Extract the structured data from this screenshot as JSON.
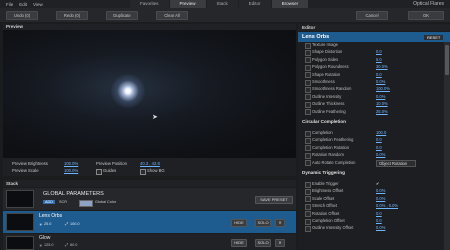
{
  "menu": [
    "File",
    "Edit",
    "View"
  ],
  "tabs": [
    {
      "label": "Favorites",
      "active": false
    },
    {
      "label": "Preview",
      "active": true
    },
    {
      "label": "Stack",
      "active": false
    },
    {
      "label": "Editor",
      "active": false
    },
    {
      "label": "Browser",
      "active": false
    }
  ],
  "app_title": "Optical Flares",
  "toolbar": {
    "undo": "Undo (0)",
    "redo": "Redo (0)",
    "duplicate": "Duplicate",
    "clear_all": "Clear All",
    "cancel": "Cancel",
    "ok": "OK"
  },
  "preview": {
    "heading": "Preview",
    "brightness_label": "Preview Brightness",
    "brightness_value": "100.0%",
    "scale_label": "Preview Scale",
    "scale_value": "100.0%",
    "position_label": "Preview Position",
    "position_value": "40.3 , 42.8",
    "guides_label": "Guides",
    "show_bg_label": "Show BG"
  },
  "stack": {
    "heading": "Stack",
    "global_title": "GLOBAL PARAMETERS",
    "global_tags": [
      "ADD",
      "SCR"
    ],
    "global_color_label": "Global Color",
    "save_preset": "SAVE PRESET",
    "items": [
      {
        "name": "Lens Orbs",
        "brightness": "25.0",
        "scale": "100.0",
        "hide": "HIDE",
        "solo": "SOLO",
        "selected": true
      },
      {
        "name": "Glow",
        "brightness": "125.0",
        "scale": "80.0",
        "hide": "HIDE",
        "solo": "SOLO",
        "selected": false
      }
    ]
  },
  "editor": {
    "heading": "Editor",
    "title": "Lens Orbs",
    "reset": "RESET",
    "rows_top": [
      {
        "label": "Texture Image",
        "value": ""
      },
      {
        "label": "Shape Distortion",
        "value": "0.0"
      },
      {
        "label": "Polygon Sides",
        "value": "6.0"
      },
      {
        "label": "Polygon Roundness",
        "value": "30.0%"
      },
      {
        "label": "Shape Rotation",
        "value": "0.0"
      },
      {
        "label": "Smoothness",
        "value": "0.0%"
      },
      {
        "label": "Smoothness Random",
        "value": "100.0%"
      },
      {
        "label": "Outline Intensity",
        "value": "0.0%"
      },
      {
        "label": "Outline Thickness",
        "value": "10.0%"
      },
      {
        "label": "Outline Feathering",
        "value": "25.0%"
      }
    ],
    "section_circular": "Circular Completion",
    "rows_circular": [
      {
        "label": "Completion",
        "value": "100.0"
      },
      {
        "label": "Completion Feathering",
        "value": "0.0"
      },
      {
        "label": "Completion Rotation",
        "value": "0.0"
      },
      {
        "label": "Rotation Random",
        "value": "0.0%"
      },
      {
        "label": "Auto Rotate Completion",
        "value": "Object Rotation"
      }
    ],
    "section_dynamic": "Dynamic Triggering",
    "rows_dynamic": [
      {
        "label": "Enable Trigger",
        "value": "✔"
      },
      {
        "label": "Brightness Offset",
        "value": "0.0%"
      },
      {
        "label": "Scale Offset",
        "value": "0.0%"
      },
      {
        "label": "Stretch Offset",
        "value": "0.0% , 0.0%"
      },
      {
        "label": "Rotation Offset",
        "value": "0.0"
      },
      {
        "label": "Completion Offset",
        "value": "0.0"
      },
      {
        "label": "Outline Intensity Offset",
        "value": "0.0%"
      }
    ]
  },
  "colors": {
    "accent": "#1e5b8e",
    "link": "#6fb4ff",
    "bg": "#1b1c1e"
  }
}
